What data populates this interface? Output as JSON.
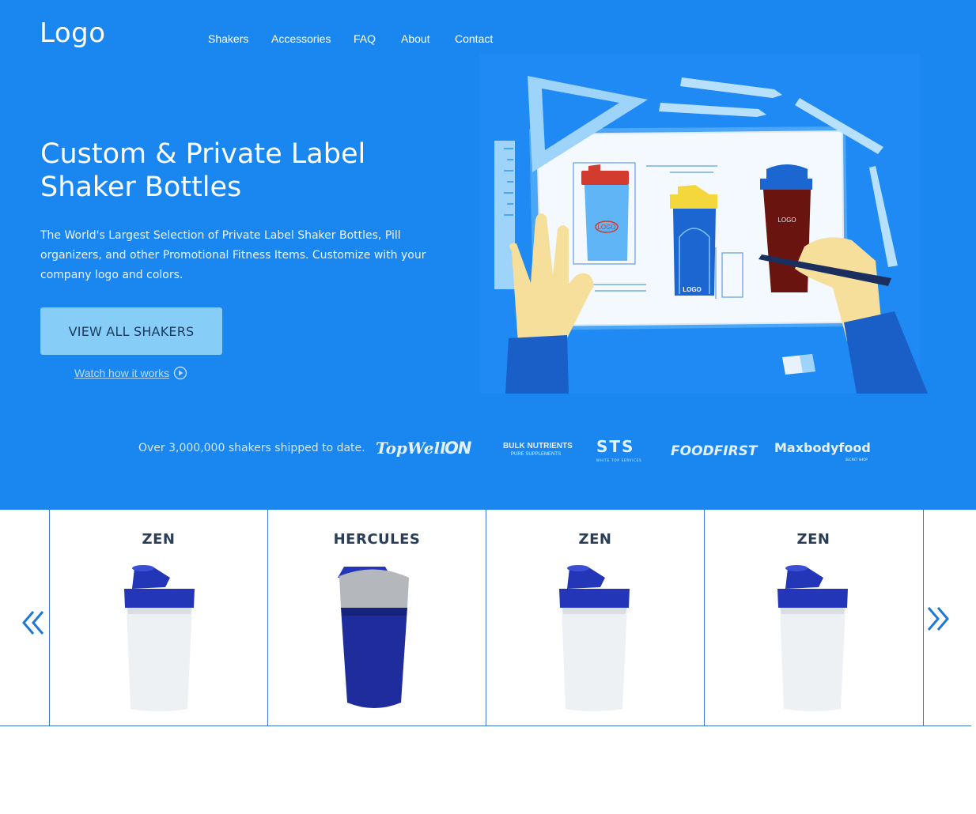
{
  "header": {
    "logo": "Logo",
    "nav": [
      {
        "label": "Shakers"
      },
      {
        "label": "Accessories"
      },
      {
        "label": "FAQ"
      },
      {
        "label": "About"
      },
      {
        "label": "Contact"
      }
    ]
  },
  "hero": {
    "headline_line1": "Custom & Private Label",
    "headline_line2": "Shaker Bottles",
    "description": "The World's Largest Selection of Private Label Shaker Bottles, Pill organizers, and other Promotional Fitness Items. Customize with your company logo and colors.",
    "cta_label": "VIEW ALL SHAKERS",
    "watch_label": "Watch how it works"
  },
  "illustration": {
    "label_logo_1": "LOGO",
    "label_logo_2": "LOGO",
    "label_logo_3": "LOGO"
  },
  "brands": {
    "shipped_text": "Over 3,000,000 shakers shipped to date.",
    "logos": [
      {
        "name": "TopWell"
      },
      {
        "name": "ON"
      },
      {
        "name": "BULK NUTRIENTS",
        "tagline": "PURE SUPPLEMENTS"
      },
      {
        "name": "STS",
        "tagline": "WHITE TOP SERVICES"
      },
      {
        "name": "FOODFIRST"
      },
      {
        "name": "Maxbodyfood",
        "tagline": "SECRET SHOP"
      }
    ]
  },
  "products": [
    {
      "name": "ZEN",
      "lid_color": "#2436b8",
      "body_color": "#eef1f4"
    },
    {
      "name": "HERCULES",
      "lid_color": "#b4b8bd",
      "body_color": "#1e2c9c"
    },
    {
      "name": "ZEN",
      "lid_color": "#2436b8",
      "body_color": "#eef1f4"
    },
    {
      "name": "ZEN",
      "lid_color": "#2436b8",
      "body_color": "#eef1f4"
    }
  ],
  "colors": {
    "hero_bg": "#1a87f0",
    "cta_bg": "#86cdf8",
    "accent": "#1f78d4"
  }
}
